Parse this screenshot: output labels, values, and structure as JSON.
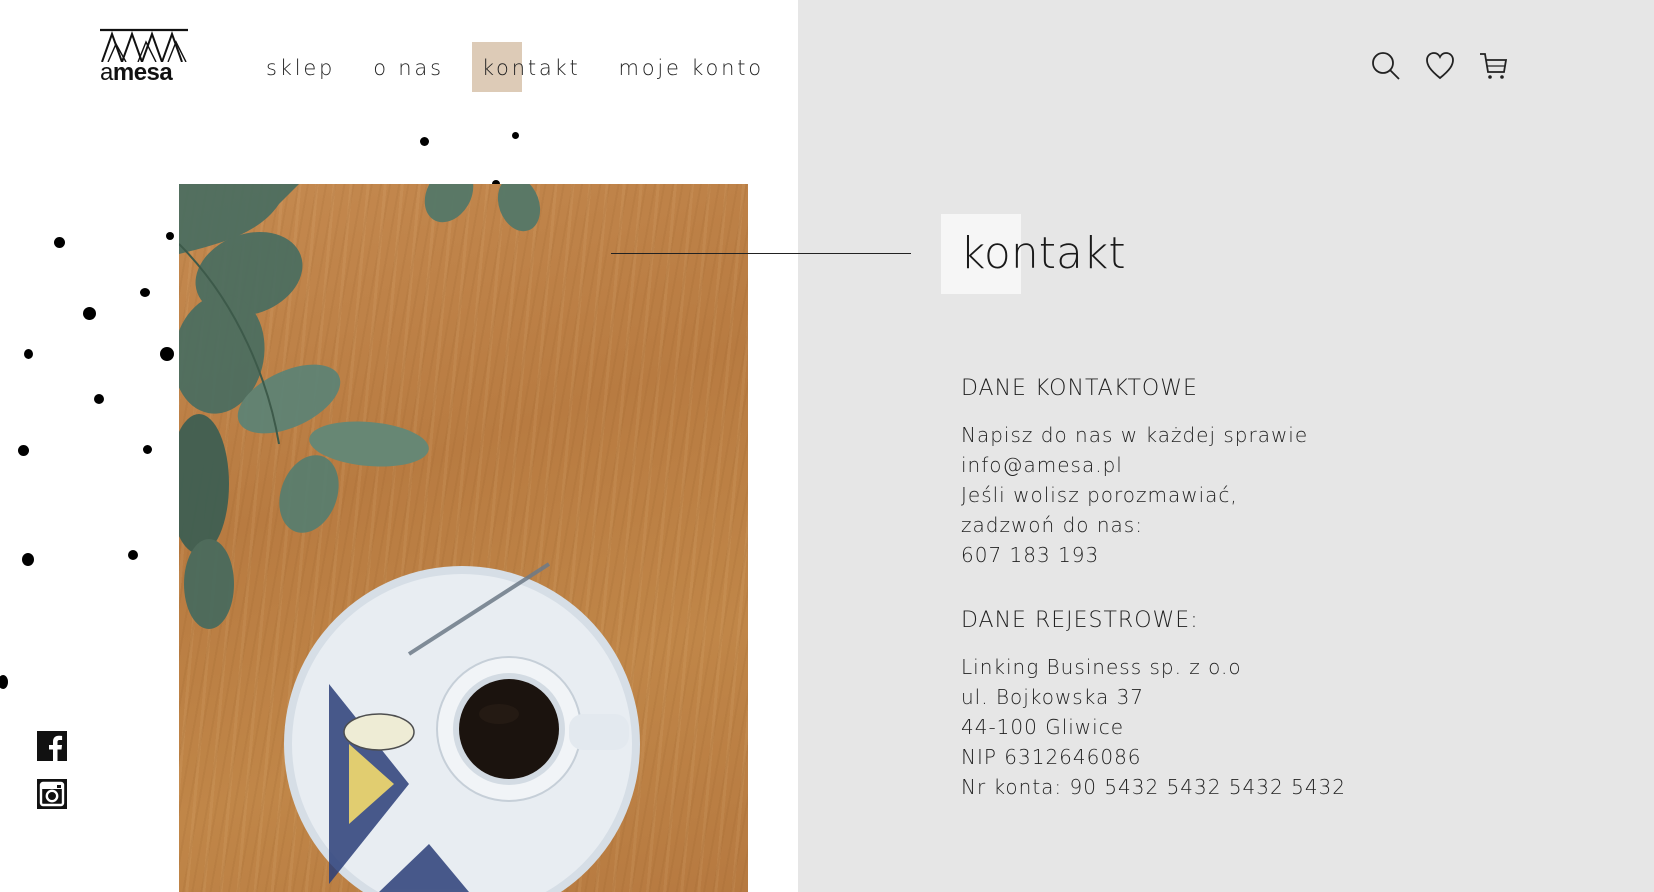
{
  "brand": {
    "logo_text_a": "a",
    "logo_text_rest": "mesa"
  },
  "nav": {
    "items": [
      {
        "label": "sklep"
      },
      {
        "label": "o nas"
      },
      {
        "label": "kontakt",
        "active": true
      },
      {
        "label": "moje konto"
      }
    ]
  },
  "header_icons": [
    "search-icon",
    "heart-icon",
    "cart-icon"
  ],
  "social": [
    "facebook-icon",
    "instagram-icon"
  ],
  "colors": {
    "right_panel": "#e6e6e6",
    "nav_highlight": "#ddcbb7",
    "text": "#1d1d1d"
  },
  "page": {
    "heading": "kontakt"
  },
  "contact": {
    "title": "DANE KONTAKTOWE",
    "line1": "Napisz do nas w każdej sprawie",
    "email": "info@amesa.pl",
    "line3": "Jeśli wolisz porozmawiać,",
    "line4": "zadzwoń do nas:",
    "phone": "607 183 193"
  },
  "registration": {
    "title": "DANE REJESTROWE:",
    "company": "Linking Business sp. z o.o",
    "street": "ul. Bojkowska 37",
    "city": "44-100 Gliwice",
    "nip": "NIP 6312646086",
    "account": "Nr konta: 90 5432 5432 5432 5432"
  }
}
